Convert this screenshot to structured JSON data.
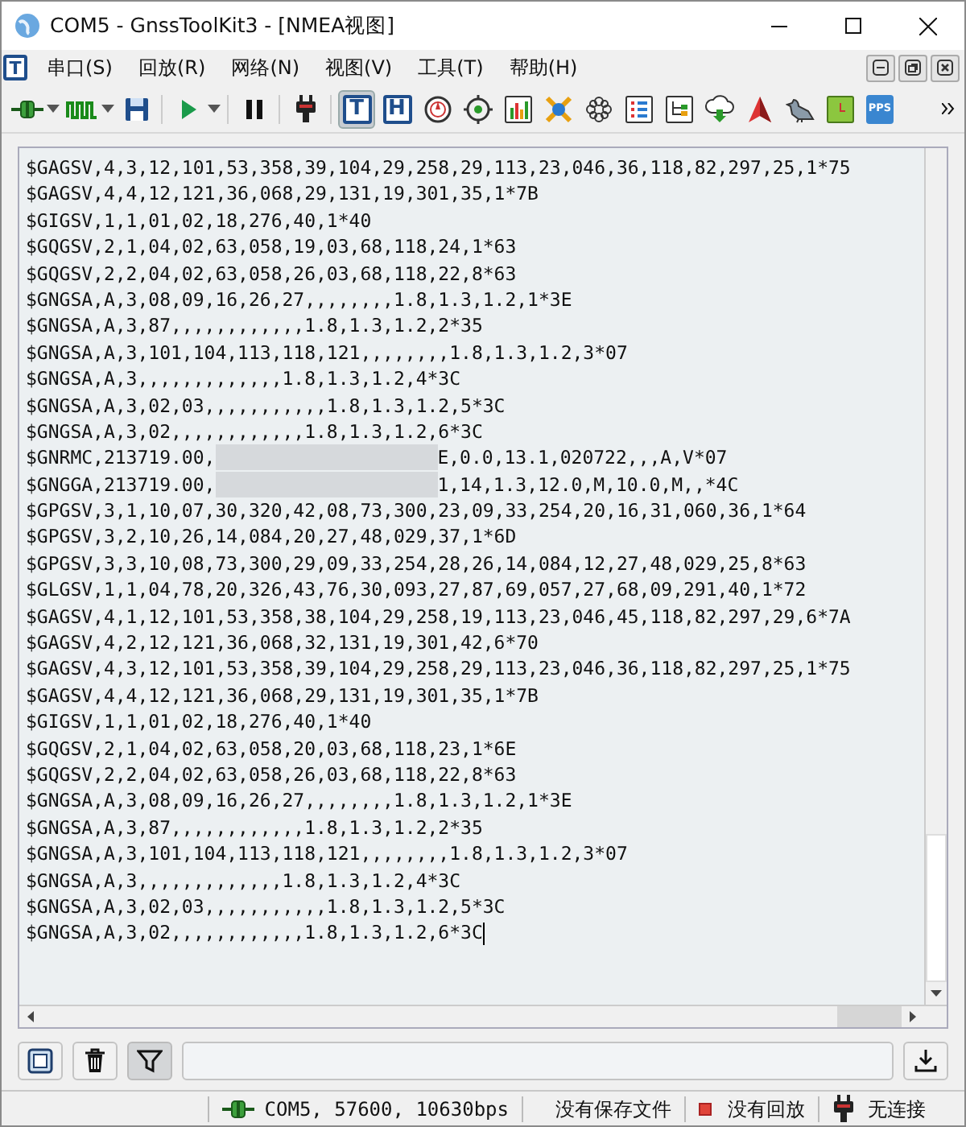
{
  "window": {
    "title": "COM5 - GnssToolKit3 - [NMEA视图]"
  },
  "menu_icon": {
    "label": "T"
  },
  "menu": [
    {
      "label": "串口(S)"
    },
    {
      "label": "回放(R)"
    },
    {
      "label": "网络(N)"
    },
    {
      "label": "视图(V)"
    },
    {
      "label": "工具(T)"
    },
    {
      "label": "帮助(H)"
    }
  ],
  "toolbar": [
    {
      "selected": false,
      "dropdown": true
    },
    {
      "selected": false,
      "dropdown": true
    },
    {
      "selected": false,
      "dropdown": false
    },
    {
      "selected": false,
      "dropdown": true
    },
    {
      "selected": false,
      "dropdown": false
    },
    {
      "selected": false,
      "dropdown": false
    },
    {
      "selected": true,
      "dropdown": false,
      "label": "T"
    },
    {
      "selected": false,
      "dropdown": false,
      "label": "H"
    },
    {
      "selected": false,
      "dropdown": false
    },
    {
      "selected": false,
      "dropdown": false
    },
    {
      "selected": false,
      "dropdown": false
    },
    {
      "selected": false,
      "dropdown": false
    },
    {
      "selected": false,
      "dropdown": false
    },
    {
      "selected": false,
      "dropdown": false
    },
    {
      "selected": false,
      "dropdown": false
    },
    {
      "selected": false,
      "dropdown": false
    },
    {
      "selected": false,
      "dropdown": false
    },
    {
      "selected": false,
      "dropdown": false
    },
    {
      "selected": false,
      "dropdown": false
    },
    {
      "selected": false,
      "dropdown": false,
      "label": "PPS"
    }
  ],
  "log": {
    "caret": true,
    "lines": [
      {
        "kind": "plain",
        "text": "$GAGSV,4,3,12,101,53,358,39,104,29,258,29,113,23,046,36,118,82,297,25,1*75"
      },
      {
        "kind": "plain",
        "text": "$GAGSV,4,4,12,121,36,068,29,131,19,301,35,1*7B"
      },
      {
        "kind": "plain",
        "text": "$GIGSV,1,1,01,02,18,276,40,1*40"
      },
      {
        "kind": "plain",
        "text": "$GQGSV,2,1,04,02,63,058,19,03,68,118,24,1*63"
      },
      {
        "kind": "plain",
        "text": "$GQGSV,2,2,04,02,63,058,26,03,68,118,22,8*63"
      },
      {
        "kind": "plain",
        "text": "$GNGSA,A,3,08,09,16,26,27,,,,,,,,1.8,1.3,1.2,1*3E"
      },
      {
        "kind": "plain",
        "text": "$GNGSA,A,3,87,,,,,,,,,,,,1.8,1.3,1.2,2*35"
      },
      {
        "kind": "plain",
        "text": "$GNGSA,A,3,101,104,113,118,121,,,,,,,,1.8,1.3,1.2,3*07"
      },
      {
        "kind": "plain",
        "text": "$GNGSA,A,3,,,,,,,,,,,,,1.8,1.3,1.2,4*3C"
      },
      {
        "kind": "plain",
        "text": "$GNGSA,A,3,02,03,,,,,,,,,,,1.8,1.3,1.2,5*3C"
      },
      {
        "kind": "plain",
        "text": "$GNGSA,A,3,02,,,,,,,,,,,,1.8,1.3,1.2,6*3C"
      },
      {
        "kind": "redacted",
        "before": "$GNRMC,213719.00,",
        "after": "E,0.0,13.1,020722,,,A,V*07"
      },
      {
        "kind": "redacted",
        "before": "$GNGGA,213719.00,",
        "after": "1,14,1.3,12.0,M,10.0,M,,*4C"
      },
      {
        "kind": "plain",
        "text": "$GPGSV,3,1,10,07,30,320,42,08,73,300,23,09,33,254,20,16,31,060,36,1*64"
      },
      {
        "kind": "plain",
        "text": "$GPGSV,3,2,10,26,14,084,20,27,48,029,37,1*6D"
      },
      {
        "kind": "plain",
        "text": "$GPGSV,3,3,10,08,73,300,29,09,33,254,28,26,14,084,12,27,48,029,25,8*63"
      },
      {
        "kind": "plain",
        "text": "$GLGSV,1,1,04,78,20,326,43,76,30,093,27,87,69,057,27,68,09,291,40,1*72"
      },
      {
        "kind": "plain",
        "text": "$GAGSV,4,1,12,101,53,358,38,104,29,258,19,113,23,046,45,118,82,297,29,6*7A"
      },
      {
        "kind": "plain",
        "text": "$GAGSV,4,2,12,121,36,068,32,131,19,301,42,6*70"
      },
      {
        "kind": "plain",
        "text": "$GAGSV,4,3,12,101,53,358,39,104,29,258,29,113,23,046,36,118,82,297,25,1*75"
      },
      {
        "kind": "plain",
        "text": "$GAGSV,4,4,12,121,36,068,29,131,19,301,35,1*7B"
      },
      {
        "kind": "plain",
        "text": "$GIGSV,1,1,01,02,18,276,40,1*40"
      },
      {
        "kind": "plain",
        "text": "$GQGSV,2,1,04,02,63,058,20,03,68,118,23,1*6E"
      },
      {
        "kind": "plain",
        "text": "$GQGSV,2,2,04,02,63,058,26,03,68,118,22,8*63"
      },
      {
        "kind": "plain",
        "text": "$GNGSA,A,3,08,09,16,26,27,,,,,,,,1.8,1.3,1.2,1*3E"
      },
      {
        "kind": "plain",
        "text": "$GNGSA,A,3,87,,,,,,,,,,,,1.8,1.3,1.2,2*35"
      },
      {
        "kind": "plain",
        "text": "$GNGSA,A,3,101,104,113,118,121,,,,,,,,1.8,1.3,1.2,3*07"
      },
      {
        "kind": "plain",
        "text": "$GNGSA,A,3,,,,,,,,,,,,,1.8,1.3,1.2,4*3C"
      },
      {
        "kind": "plain",
        "text": "$GNGSA,A,3,02,03,,,,,,,,,,,1.8,1.3,1.2,5*3C"
      },
      {
        "kind": "plain",
        "text": "$GNGSA,A,3,02,,,,,,,,,,,,1.8,1.3,1.2,6*3C"
      }
    ]
  },
  "bottom_bar": {
    "buttons": [
      {
        "pressed": false
      },
      {
        "pressed": false
      },
      {
        "pressed": true
      }
    ]
  },
  "status_bar": {
    "connection": "COM5, 57600, 10630bps",
    "save": "没有保存文件",
    "playback": "没有回放",
    "network": "无连接"
  }
}
